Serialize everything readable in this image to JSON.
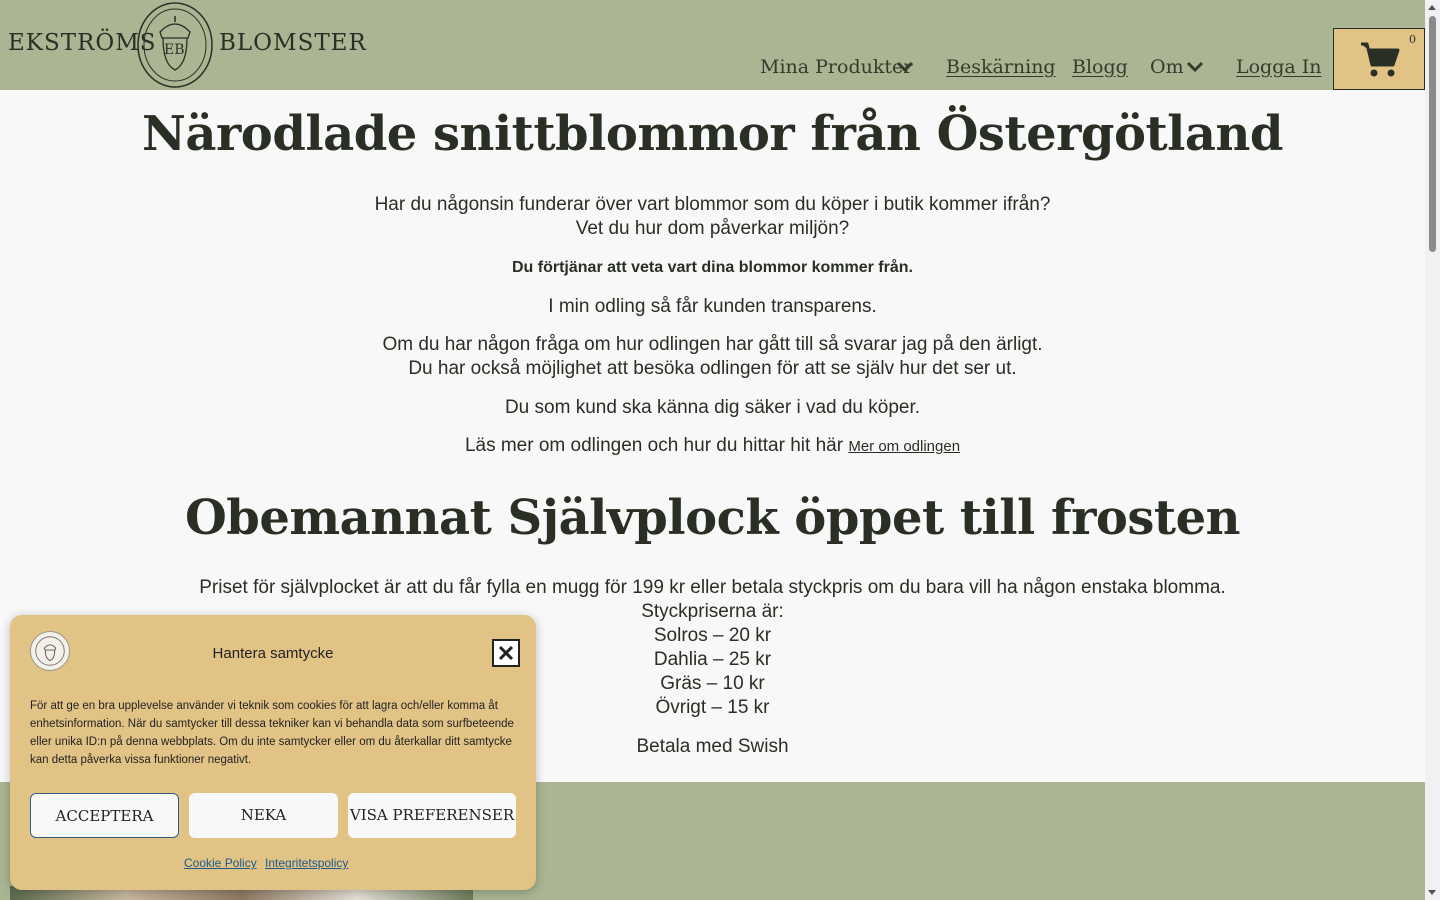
{
  "header": {
    "logo_left": "EKSTRÖMS",
    "logo_right": "BLOMSTER",
    "logo_monogram": "EB",
    "nav": {
      "products": "Mina Produkter",
      "beskarning": "Beskärning",
      "blogg": "Blogg",
      "om": "Om",
      "login": "Logga In"
    },
    "cart_count": "0"
  },
  "main": {
    "heading1": "Närodlade snittblommor från Östergötland",
    "p1_line1": "Har du någonsin funderar över vart blommor som du köper i butik kommer ifrån?",
    "p1_line2": "Vet du hur dom påverkar miljön?",
    "p2_bold": "Du förtjänar att veta vart dina blommor kommer från.",
    "p3": "I min odling så får kunden transparens.",
    "p4_line1": "Om du har någon fråga om hur odlingen har gått till så svarar jag på den ärligt.",
    "p4_line2": "Du har också möjlighet att besöka odlingen för att se själv hur det ser ut.",
    "p5": "Du som kund ska känna dig säker i vad du köper.",
    "p6_text": "Läs mer om odlingen och hur du hittar hit här ",
    "p6_link": "Mer om odlingen",
    "heading2": "Obemannat Självplock öppet till frosten",
    "price_intro": "Priset för självplocket är att du får fylla en mugg för 199 kr eller betala styckpris om du bara vill ha någon enstaka blomma.",
    "price_title": "Styckpriserna är:",
    "prices": [
      "Solros – 20 kr",
      "Dahlia – 25 kr",
      "Gräs – 10 kr",
      "Övrigt – 15 kr"
    ],
    "swish": "Betala med Swish"
  },
  "consent": {
    "title": "Hantera samtycke",
    "text": "För att ge en bra upplevelse använder vi teknik som cookies för att lagra och/eller komma åt enhetsinformation. När du samtycker till dessa tekniker kan vi behandla data som surfbeteende eller unika ID:n på denna webbplats. Om du inte samtycker eller om du återkallar ditt samtycke kan detta påverka vissa funktioner negativt.",
    "accept": "ACCEPTERA",
    "deny": "NEKA",
    "prefs": "VISA PREFERENSER",
    "cookie_policy": "Cookie Policy",
    "privacy_policy": "Integritetspolicy"
  }
}
